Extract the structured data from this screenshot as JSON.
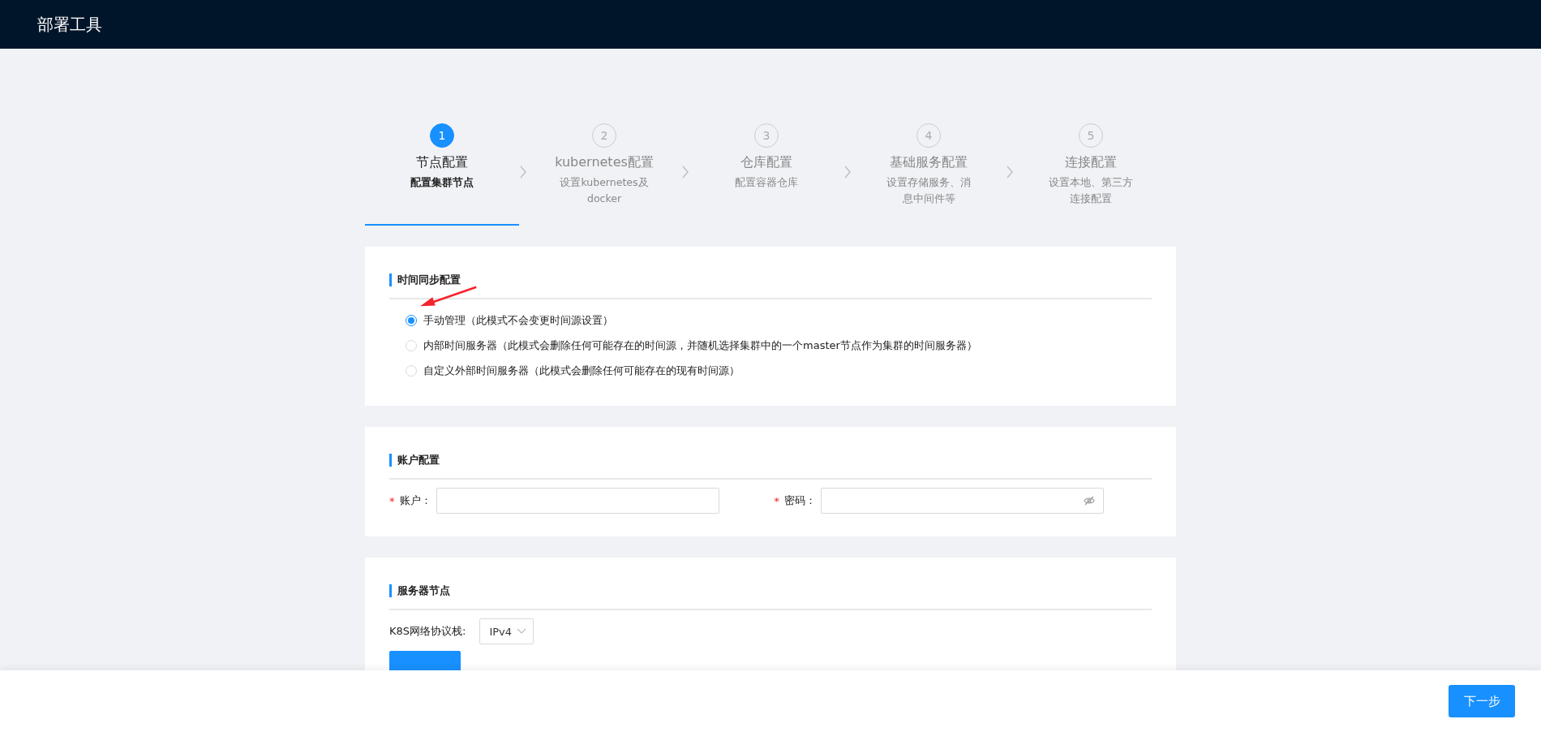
{
  "header": {
    "title": "部署工具"
  },
  "steps": [
    {
      "number": "1",
      "title": "节点配置",
      "description": "配置集群节点",
      "selected": true
    },
    {
      "number": "2",
      "title": "kubernetes配置",
      "description": "设置kubernetes及docker",
      "selected": false
    },
    {
      "number": "3",
      "title": "仓库配置",
      "description": "配置容器仓库",
      "selected": false
    },
    {
      "number": "4",
      "title": "基础服务配置",
      "description": "设置存储服务、消息中间件等",
      "selected": false
    },
    {
      "number": "5",
      "title": "连接配置",
      "description": "设置本地、第三方连接配置",
      "selected": false
    }
  ],
  "time_sync": {
    "title": "时间同步配置",
    "options": [
      {
        "label": "手动管理（此模式不会变更时间源设置）",
        "selected": true
      },
      {
        "label": "内部时间服务器（此模式会删除任何可能存在的时间源，并随机选择集群中的一个master节点作为集群的时间服务器）",
        "selected": false
      },
      {
        "label": "自定义外部时间服务器（此模式会删除任何可能存在的现有时间源）",
        "selected": false
      }
    ]
  },
  "account": {
    "title": "账户配置",
    "fields": [
      {
        "required_mark": "*",
        "label": "账户：",
        "kind": "text"
      },
      {
        "required_mark": "*",
        "label": "密码：",
        "kind": "password"
      }
    ]
  },
  "servers": {
    "title": "服务器节点",
    "protocol_label": "K8S网络协议栈:",
    "protocol_value": "IPv4"
  },
  "footer": {
    "next_button": "下一步"
  }
}
